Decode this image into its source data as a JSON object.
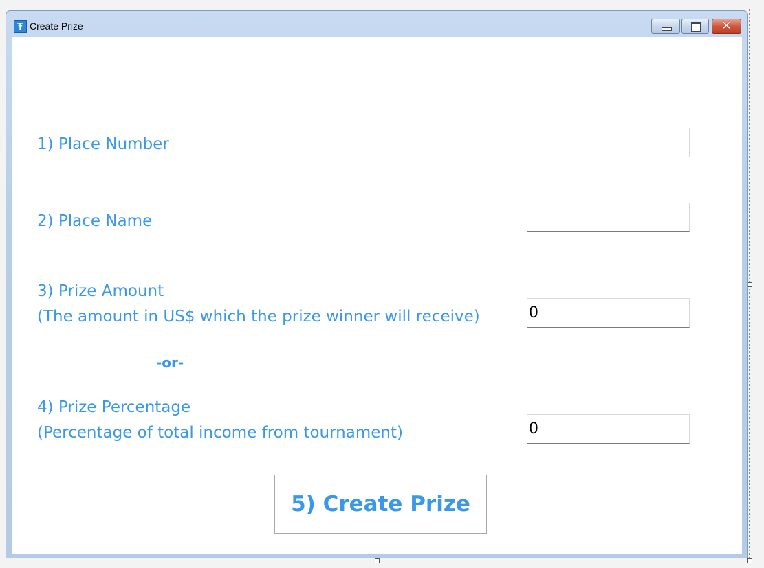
{
  "window": {
    "title": "Create Prize",
    "icon": "app-icon",
    "controls": {
      "minimize": "minimize-icon",
      "maximize": "maximize-icon",
      "close": "✕"
    }
  },
  "form": {
    "place_number": {
      "label": "1) Place Number",
      "value": ""
    },
    "place_name": {
      "label": "2) Place Name",
      "value": ""
    },
    "prize_amount": {
      "label": "3) Prize Amount",
      "sublabel": "(The amount in US$ which the prize winner will receive)",
      "value": "0"
    },
    "or_label": "-or-",
    "prize_percentage": {
      "label": "4) Prize Percentage",
      "sublabel": "(Percentage of total income from tournament)",
      "value": "0"
    },
    "create_button_label": "5) Create Prize"
  },
  "colors": {
    "label_blue": "#3a98e9",
    "client_bg": "#ffffff",
    "frame_blue": "#b7cde9",
    "close_red": "#c23d22"
  }
}
